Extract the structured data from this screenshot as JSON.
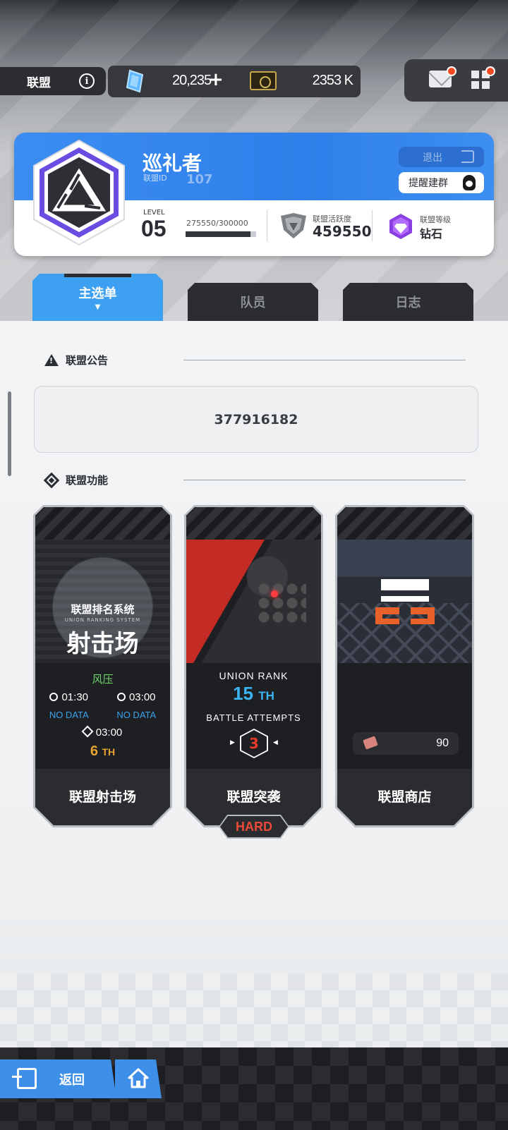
{
  "header": {
    "title": "联盟",
    "gems": "20,235",
    "gems_plus": "+",
    "coins": "2353 K",
    "icons": [
      "info-icon",
      "gem-icon",
      "ticket-icon",
      "mail-icon",
      "menu-grid-icon"
    ]
  },
  "union": {
    "name": "巡礼者",
    "id_label": "联盟ID",
    "id": "107",
    "leave_label": "退出",
    "remind_label": "提醒建群",
    "level_label": "LEVEL",
    "level": "05",
    "exp_text": "275550/300000",
    "exp_progress": 0.9185,
    "activity_label": "联盟活跃度",
    "activity_value": "459550",
    "rank_label": "联盟等级",
    "rank_value": "钻石"
  },
  "tabs": {
    "main": "主选单",
    "main_caret": "▼",
    "members": "队员",
    "log": "日志"
  },
  "notice": {
    "heading": "联盟公告",
    "text": "377916182"
  },
  "functions": {
    "heading": "联盟功能",
    "shooting": {
      "subtitle": "联盟排名系统",
      "subtitle_en": "UNION RANKING SYSTEM",
      "big_title": "射击场",
      "wind": "风压",
      "time1": "01:30",
      "time2": "03:00",
      "nodata1": "NO DATA",
      "nodata2": "NO DATA",
      "time3": "03:00",
      "rank_num": "6",
      "rank_suffix": "TH",
      "label": "联盟射击场"
    },
    "raid": {
      "rank_label": "UNION RANK",
      "rank_num": "15",
      "rank_suffix": "TH",
      "attempts_label": "BATTLE ATTEMPTS",
      "attempts": "3",
      "label": "联盟突袭",
      "difficulty": "HARD"
    },
    "shop": {
      "price": "90",
      "label": "联盟商店"
    }
  },
  "footer": {
    "back_label": "返回"
  },
  "colors": {
    "accent_blue": "#3e8fe8",
    "notify_red": "#f04a24",
    "rank_orange": "#e6a332",
    "raid_cyan": "#3ab4f2",
    "hard_red": "#ec4a38",
    "wind_green": "#6fd66a"
  }
}
